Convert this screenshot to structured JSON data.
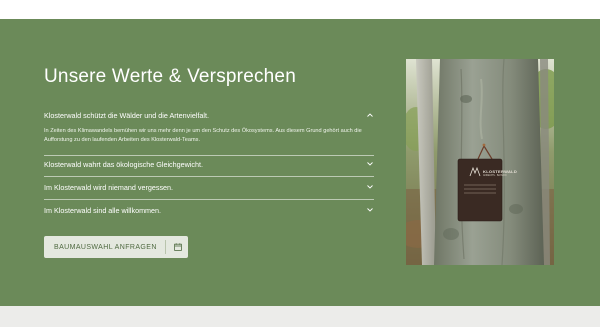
{
  "section": {
    "title": "Unsere Werte & Versprechen"
  },
  "accordion": [
    {
      "title": "Klosterwald schützt die Wälder und die Artenvielfalt.",
      "expanded": true,
      "body": "In Zeiten des Klimawandels bemühen wir uns mehr denn je um den Schutz des Ökosystems. Aus diesem Grund gehört auch die Aufforstung zu den laufenden Arbeiten des Klosterwald-Teams."
    },
    {
      "title": "Klosterwald wahrt das ökologische Gleichgewicht.",
      "expanded": false
    },
    {
      "title": "Im Klosterwald wird niemand vergessen.",
      "expanded": false
    },
    {
      "title": "Im Klosterwald sind alle willkommen.",
      "expanded": false
    }
  ],
  "cta": {
    "label": "BAUMAUSWAHL ANFRAGEN",
    "icon": "calendar-icon"
  },
  "image": {
    "sign": {
      "brand": "KLOSTERWALD",
      "subtitle": "ANDECHS · BAYERN"
    }
  },
  "colors": {
    "section_background": "#6b8a59",
    "text": "#ffffff",
    "button_background": "#e4e8df",
    "button_text": "#4f6a41",
    "footer_background": "#ececea"
  }
}
